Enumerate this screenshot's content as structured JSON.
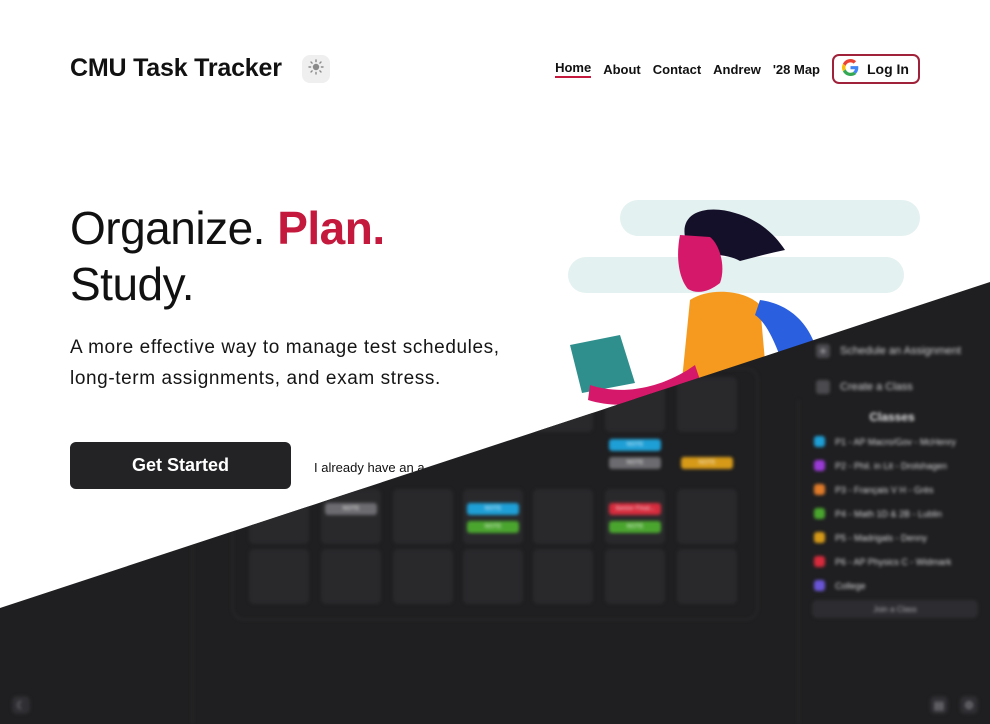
{
  "header": {
    "brand": "CMU Task Tracker",
    "theme_icon": "sun-icon",
    "nav": [
      "Home",
      "About",
      "Contact",
      "Andrew",
      "'28 Map"
    ],
    "login_label": "Log In",
    "login_icon": "google-icon"
  },
  "hero": {
    "title_word1": "Organize.",
    "title_word2": "Plan.",
    "title_word3": "Study.",
    "subtitle": "A more effective way to manage test schedules, long-term assignments, and exam stress.",
    "cta_label": "Get Started",
    "secondary_label": "I already have an a"
  },
  "colors": {
    "accent": "#c4183c",
    "dark_bg": "#1f1f21"
  },
  "preview": {
    "actions": [
      "Schedule an Assignment",
      "Create a Class"
    ],
    "classes_title": "Classes",
    "classes": [
      {
        "name": "P1 - AP Macro/Gov - McHenry",
        "color": "#1e9fd6"
      },
      {
        "name": "P2 - Phil. in Lit - Drolshagen",
        "color": "#9a3ad6"
      },
      {
        "name": "P3 - Français V H - Grès",
        "color": "#e07b2a"
      },
      {
        "name": "P4 - Math 1D & 2B - Lublin",
        "color": "#4aa52e"
      },
      {
        "name": "P5 - Madrigals - Denny",
        "color": "#d69a18"
      },
      {
        "name": "P6 - AP Physics C - Widmark",
        "color": "#d62b3c"
      },
      {
        "name": "College",
        "color": "#6a55d6"
      }
    ],
    "join_label": "Join a Class",
    "chips": {
      "note": "NOTE",
      "a": "Senior Final..."
    }
  }
}
